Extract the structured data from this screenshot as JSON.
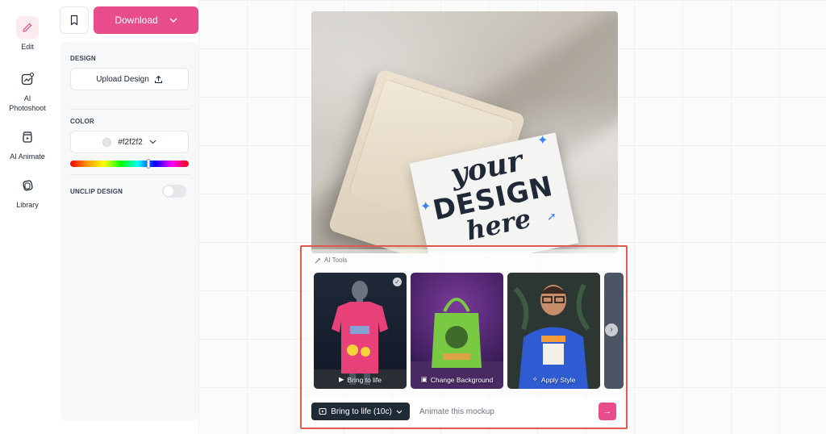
{
  "rail": {
    "items": [
      {
        "label": "Edit",
        "icon": "pencil-icon",
        "active": true
      },
      {
        "label": "AI\nPhotoshoot",
        "icon": "ai-photo-icon",
        "active": false
      },
      {
        "label": "AI Animate",
        "icon": "clapper-icon",
        "active": false
      },
      {
        "label": "Library",
        "icon": "library-icon",
        "active": false
      }
    ]
  },
  "toolbar": {
    "download_label": "Download",
    "bookmark_icon": "bookmark-icon"
  },
  "panel": {
    "design_title": "DESIGN",
    "upload_label": "Upload Design",
    "color_title": "COLOR",
    "color_value": "#f2f2f2",
    "unclip_label": "UNCLIP DESIGN",
    "unclip_enabled": false
  },
  "mockup": {
    "line1": "your",
    "line2": "DESIGN",
    "line3": "here"
  },
  "ai_tools": {
    "header": "AI Tools",
    "tools": [
      {
        "label": "Bring to life",
        "selected": true
      },
      {
        "label": "Change Background",
        "selected": false
      },
      {
        "label": "Apply Style",
        "selected": false
      }
    ]
  },
  "bottom_bar": {
    "action_label": "Bring to life (10c)",
    "prompt_placeholder": "Animate this mockup",
    "send_icon": "arrow-right-icon"
  },
  "colors": {
    "accent": "#e94c8a",
    "highlight_frame": "#e05a4e",
    "dark_button": "#1f2a37"
  }
}
